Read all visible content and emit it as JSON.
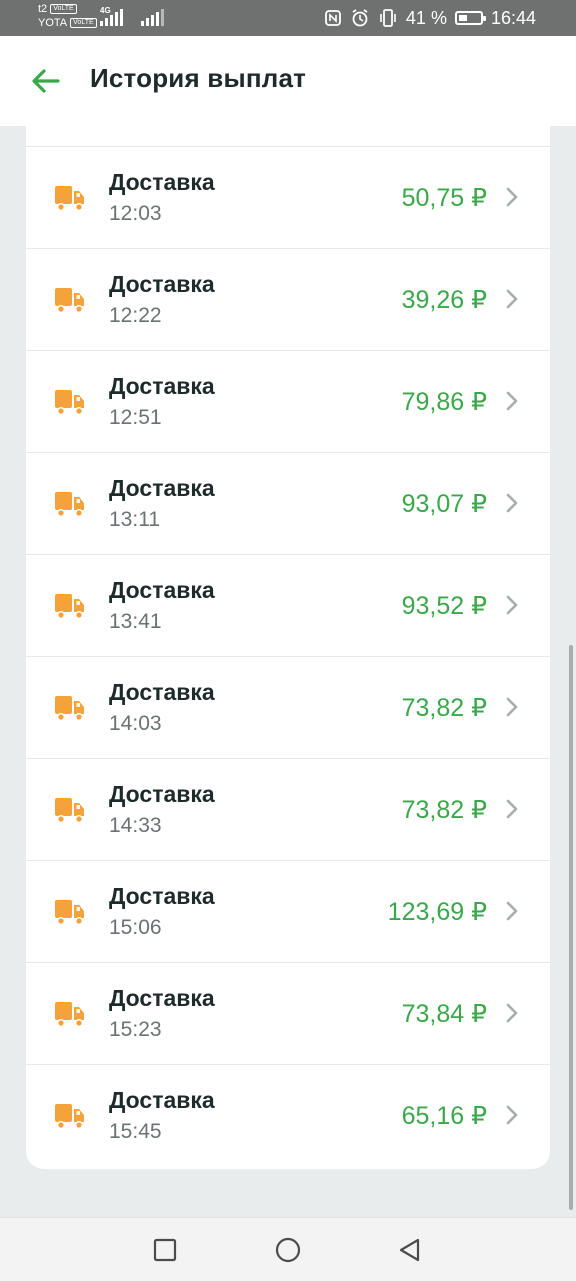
{
  "status_bar": {
    "carrier1": "t2",
    "carrier2": "YOTA",
    "volte": "VoLTE",
    "net": "4G",
    "battery_percent": "41 %",
    "battery_level": 0.41,
    "time": "16:44"
  },
  "header": {
    "title": "История выплат",
    "back_icon": "arrow-left-icon"
  },
  "payouts": [
    {
      "label": "Доставка",
      "time": "12:03",
      "amount": "50,75 ₽"
    },
    {
      "label": "Доставка",
      "time": "12:22",
      "amount": "39,26 ₽"
    },
    {
      "label": "Доставка",
      "time": "12:51",
      "amount": "79,86 ₽"
    },
    {
      "label": "Доставка",
      "time": "13:11",
      "amount": "93,07 ₽"
    },
    {
      "label": "Доставка",
      "time": "13:41",
      "amount": "93,52 ₽"
    },
    {
      "label": "Доставка",
      "time": "14:03",
      "amount": "73,82 ₽"
    },
    {
      "label": "Доставка",
      "time": "14:33",
      "amount": "73,82 ₽"
    },
    {
      "label": "Доставка",
      "time": "15:06",
      "amount": "123,69 ₽"
    },
    {
      "label": "Доставка",
      "time": "15:23",
      "amount": "73,84 ₽"
    },
    {
      "label": "Доставка",
      "time": "15:45",
      "amount": "65,16 ₽"
    }
  ],
  "colors": {
    "accent_green": "#3aa84a",
    "truck_orange": "#f5a23a",
    "title_dark": "#1f2a2b"
  },
  "navbar": {
    "recent_icon": "square-icon",
    "home_icon": "circle-icon",
    "back_icon": "triangle-back-icon"
  }
}
